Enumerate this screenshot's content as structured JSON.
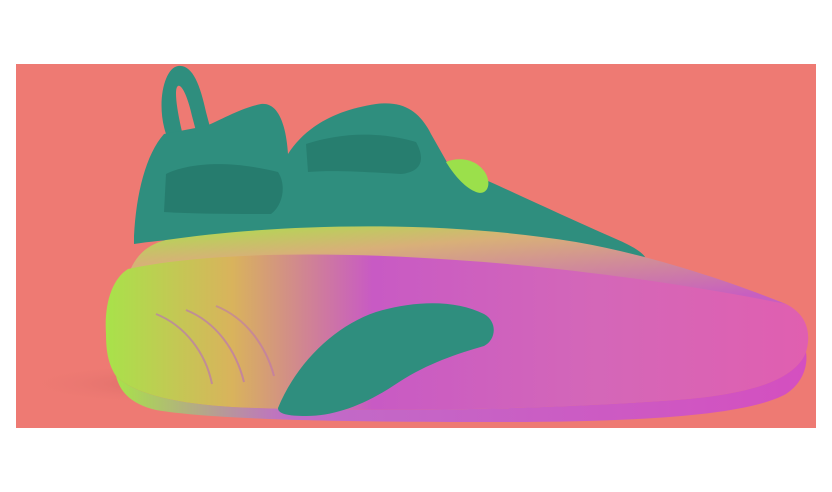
{
  "image": {
    "subject": "shoe-product-photo",
    "colors": {
      "page_background": "#ffffff",
      "backdrop": "#ee7a73",
      "upper_teal": "#2f8e7e",
      "upper_teal_dark": "#24786a",
      "midsole_magenta": "#c85ac4",
      "midsole_pink": "#e56fa0",
      "midsole_lime": "#a8e24a",
      "accent_green": "#9be04b",
      "shadow": "#d86a67"
    }
  }
}
